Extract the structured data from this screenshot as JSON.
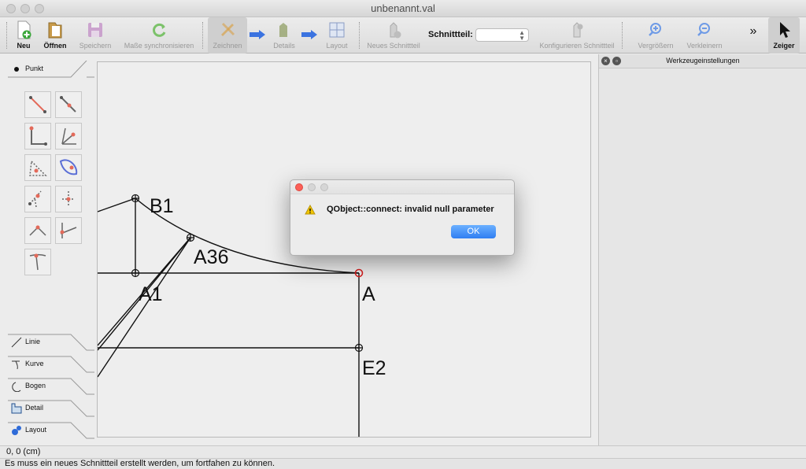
{
  "window": {
    "title": "unbenannt.val"
  },
  "toolbar": {
    "new_label": "Neu",
    "open_label": "Öffnen",
    "save_label": "Speichern",
    "sync_label": "Maße synchronisieren",
    "draw_label": "Zeichnen",
    "details_label": "Details",
    "layout_label": "Layout",
    "new_piece_label": "Neues Schnittteil",
    "piece_label": "Schnittteil:",
    "piece_value": "",
    "configure_label": "Konfigurieren Schnittteil",
    "zoom_in_label": "Vergrößern",
    "zoom_out_label": "Verkleinern",
    "more_label": "»",
    "pointer_label": "Zeiger"
  },
  "tool_tabs": {
    "point": "Punkt",
    "line": "Linie",
    "curve": "Kurve",
    "arc": "Bogen",
    "detail": "Detail",
    "layout": "Layout"
  },
  "drawing": {
    "labels": {
      "b1": "B1",
      "a36": "A36",
      "a1": "A1",
      "a": "A",
      "e2": "E2"
    },
    "selected_point_color": "#d62020"
  },
  "right_panel": {
    "title": "Werkzeugeinstellungen"
  },
  "coords": "0, 0 (cm)",
  "status": "Es muss ein neues Schnittteil erstellt werden, um fortfahen zu können.",
  "dialog": {
    "message": "QObject::connect: invalid null parameter",
    "ok_label": "OK",
    "accent_color": "#2f7ef2"
  }
}
